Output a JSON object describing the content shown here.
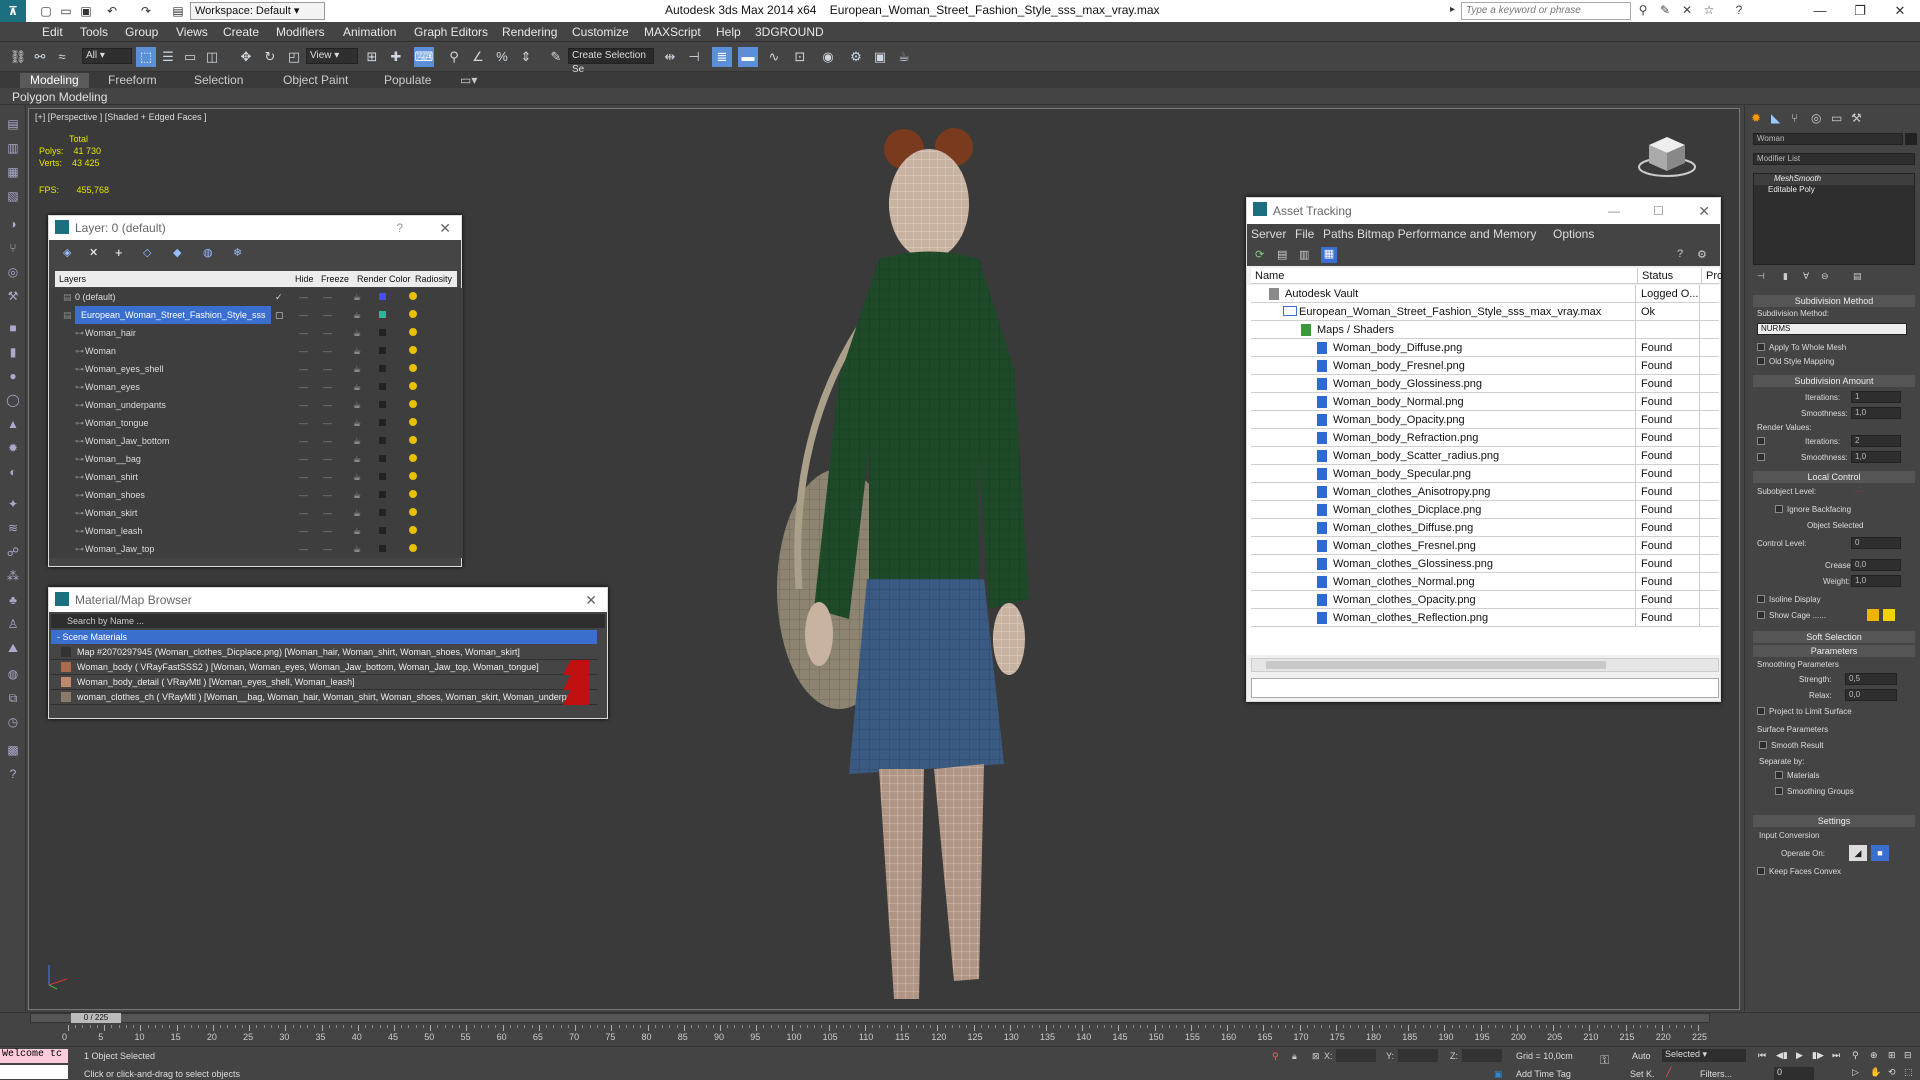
{
  "app": {
    "title": "Autodesk 3ds Max  2014 x64",
    "file": "European_Woman_Street_Fashion_Style_sss_max_vray.max",
    "workspace": "Workspace: Default",
    "search_placeholder": "Type a keyword or phrase"
  },
  "menu": [
    "Edit",
    "Tools",
    "Group",
    "Views",
    "Create",
    "Modifiers",
    "Animation",
    "Graph Editors",
    "Rendering",
    "Customize",
    "MAXScript",
    "Help",
    "3DGROUND"
  ],
  "toolbar": {
    "selection_filter": "All",
    "coord_system": "View",
    "named_selection": "Create Selection Se"
  },
  "ribbon": {
    "tabs": [
      "Modeling",
      "Freeform",
      "Selection",
      "Object Paint",
      "Populate"
    ],
    "active": "Modeling",
    "sub": "Polygon Modeling"
  },
  "viewport": {
    "label": "[+] [Perspective ] [Shaded + Edged Faces ]",
    "stats_header": "Total",
    "polys_label": "Polys:",
    "polys": "41 730",
    "verts_label": "Verts:",
    "verts": "43 425",
    "fps_label": "FPS:",
    "fps": "455,768"
  },
  "layer_panel": {
    "title": "Layer: 0 (default)",
    "help": "?",
    "columns": [
      "Layers",
      "Hide",
      "Freeze",
      "Render",
      "Color",
      "Radiosity"
    ],
    "rows": [
      {
        "name": "0 (default)",
        "color": "#4a4aff"
      },
      {
        "name": "European_Woman_Street_Fashion_Style_sss",
        "color": "#29b89a",
        "selected": true
      },
      {
        "name": "Woman_hair",
        "color": "#222"
      },
      {
        "name": "Woman",
        "color": "#222"
      },
      {
        "name": "Woman_eyes_shell",
        "color": "#222"
      },
      {
        "name": "Woman_eyes",
        "color": "#222"
      },
      {
        "name": "Woman_underpants",
        "color": "#222"
      },
      {
        "name": "Woman_tongue",
        "color": "#222"
      },
      {
        "name": "Woman_Jaw_bottom",
        "color": "#222"
      },
      {
        "name": "Woman__bag",
        "color": "#222"
      },
      {
        "name": "Woman_shirt",
        "color": "#222"
      },
      {
        "name": "Woman_shoes",
        "color": "#222"
      },
      {
        "name": "Woman_skirt",
        "color": "#222"
      },
      {
        "name": "Woman_leash",
        "color": "#222"
      },
      {
        "name": "Woman_Jaw_top",
        "color": "#222"
      }
    ]
  },
  "material_panel": {
    "title": "Material/Map Browser",
    "search_placeholder": "Search by Name ...",
    "group": "- Scene Materials",
    "items": [
      "Map #2070297945 (Woman_clothes_Dicplace.png) [Woman_hair, Woman_shirt, Woman_shoes, Woman_skirt]",
      "Woman_body  ( VRayFastSSS2 ) [Woman, Woman_eyes, Woman_Jaw_bottom, Woman_Jaw_top, Woman_tongue]",
      "Woman_body_detail  ( VRayMtl ) [Woman_eyes_shell, Woman_leash]",
      "woman_clothes_ch  ( VRayMtl ) [Woman__bag, Woman_hair, Woman_shirt, Woman_shoes, Woman_skirt, Woman_underpants]"
    ]
  },
  "asset_panel": {
    "title": "Asset Tracking",
    "menu": [
      "Server",
      "File",
      "Paths",
      "Bitmap Performance and Memory",
      "Options"
    ],
    "col_name": "Name",
    "col_status": "Status",
    "col_pro": "Pro",
    "rows": [
      {
        "name": "Autodesk Vault",
        "status": "Logged O...",
        "indent": 0
      },
      {
        "name": "European_Woman_Street_Fashion_Style_sss_max_vray.max",
        "status": "Ok",
        "indent": 1
      },
      {
        "name": "Maps / Shaders",
        "status": "",
        "indent": 2
      },
      {
        "name": "Woman_body_Diffuse.png",
        "status": "Found",
        "indent": 3
      },
      {
        "name": "Woman_body_Fresnel.png",
        "status": "Found",
        "indent": 3
      },
      {
        "name": "Woman_body_Glossiness.png",
        "status": "Found",
        "indent": 3
      },
      {
        "name": "Woman_body_Normal.png",
        "status": "Found",
        "indent": 3
      },
      {
        "name": "Woman_body_Opacity.png",
        "status": "Found",
        "indent": 3
      },
      {
        "name": "Woman_body_Refraction.png",
        "status": "Found",
        "indent": 3
      },
      {
        "name": "Woman_body_Scatter_radius.png",
        "status": "Found",
        "indent": 3
      },
      {
        "name": "Woman_body_Specular.png",
        "status": "Found",
        "indent": 3
      },
      {
        "name": "Woman_clothes_Anisotropy.png",
        "status": "Found",
        "indent": 3
      },
      {
        "name": "Woman_clothes_Dicplace.png",
        "status": "Found",
        "indent": 3
      },
      {
        "name": "Woman_clothes_Diffuse.png",
        "status": "Found",
        "indent": 3
      },
      {
        "name": "Woman_clothes_Fresnel.png",
        "status": "Found",
        "indent": 3
      },
      {
        "name": "Woman_clothes_Glossiness.png",
        "status": "Found",
        "indent": 3
      },
      {
        "name": "Woman_clothes_Normal.png",
        "status": "Found",
        "indent": 3
      },
      {
        "name": "Woman_clothes_Opacity.png",
        "status": "Found",
        "indent": 3
      },
      {
        "name": "Woman_clothes_Reflection.png",
        "status": "Found",
        "indent": 3
      }
    ]
  },
  "command_panel": {
    "object_name": "Woman",
    "modifier_list": "Modifier List",
    "stack": [
      "MeshSmooth",
      "Editable Poly"
    ],
    "subdiv_method_title": "Subdivision Method",
    "subdiv_method_label": "Subdivision Method:",
    "subdiv_method": "NURMS",
    "apply_whole": "Apply To Whole Mesh",
    "old_style": "Old Style Mapping",
    "subdiv_amount_title": "Subdivision Amount",
    "iterations_label": "Iterations:",
    "iterations": "1",
    "smoothness_label": "Smoothness:",
    "smoothness": "1,0",
    "render_values": "Render Values:",
    "r_iterations": "2",
    "r_smoothness": "1,0",
    "local_control_title": "Local Control",
    "subobject_level": "Subobject Level:",
    "ignore_backfacing": "Ignore Backfacing",
    "object_selected": "Object Selected",
    "control_level_label": "Control Level:",
    "control_level": "0",
    "crease_label": "Crease:",
    "crease": "0,0",
    "weight_label": "Weight:",
    "weight": "1,0",
    "isoline": "Isoline Display",
    "show_cage": "Show Cage ......",
    "soft_selection_title": "Soft Selection",
    "parameters_title": "Parameters",
    "smoothing_params": "Smoothing Parameters",
    "strength_label": "Strength:",
    "strength": "0,5",
    "relax_label": "Relax:",
    "relax": "0,0",
    "project_limit": "Project to Limit Surface",
    "surface_params": "Surface Parameters",
    "smooth_result": "Smooth Result",
    "separate_by": "Separate by:",
    "materials": "Materials",
    "smoothing_groups": "Smoothing Groups",
    "settings_title": "Settings",
    "input_conversion": "Input Conversion",
    "operate_on": "Operate On:",
    "keep_faces": "Keep Faces Convex"
  },
  "timeline": {
    "frame": "0 / 225",
    "ticks": [
      "0",
      "5",
      "10",
      "15",
      "20",
      "25",
      "30",
      "35",
      "40",
      "45",
      "50",
      "55",
      "60",
      "65",
      "70",
      "75",
      "80",
      "85",
      "90",
      "95",
      "100",
      "105",
      "110",
      "115",
      "120",
      "125",
      "130",
      "135",
      "140",
      "145",
      "150",
      "155",
      "160",
      "165",
      "170",
      "175",
      "180",
      "185",
      "190",
      "195",
      "200",
      "205",
      "210",
      "215",
      "220",
      "225"
    ]
  },
  "status": {
    "maxscript": "Welcome tc",
    "selected": "1 Object Selected",
    "prompt": "Click or click-and-drag to select objects",
    "x": "X:",
    "y": "Y:",
    "z": "Z:",
    "grid": "Grid = 10,0cm",
    "add_time_tag": "Add Time Tag",
    "auto": "Auto",
    "set_k": "Set K.",
    "key_mode": "Selected",
    "filters": "Filters...",
    "frame_field": "0"
  }
}
